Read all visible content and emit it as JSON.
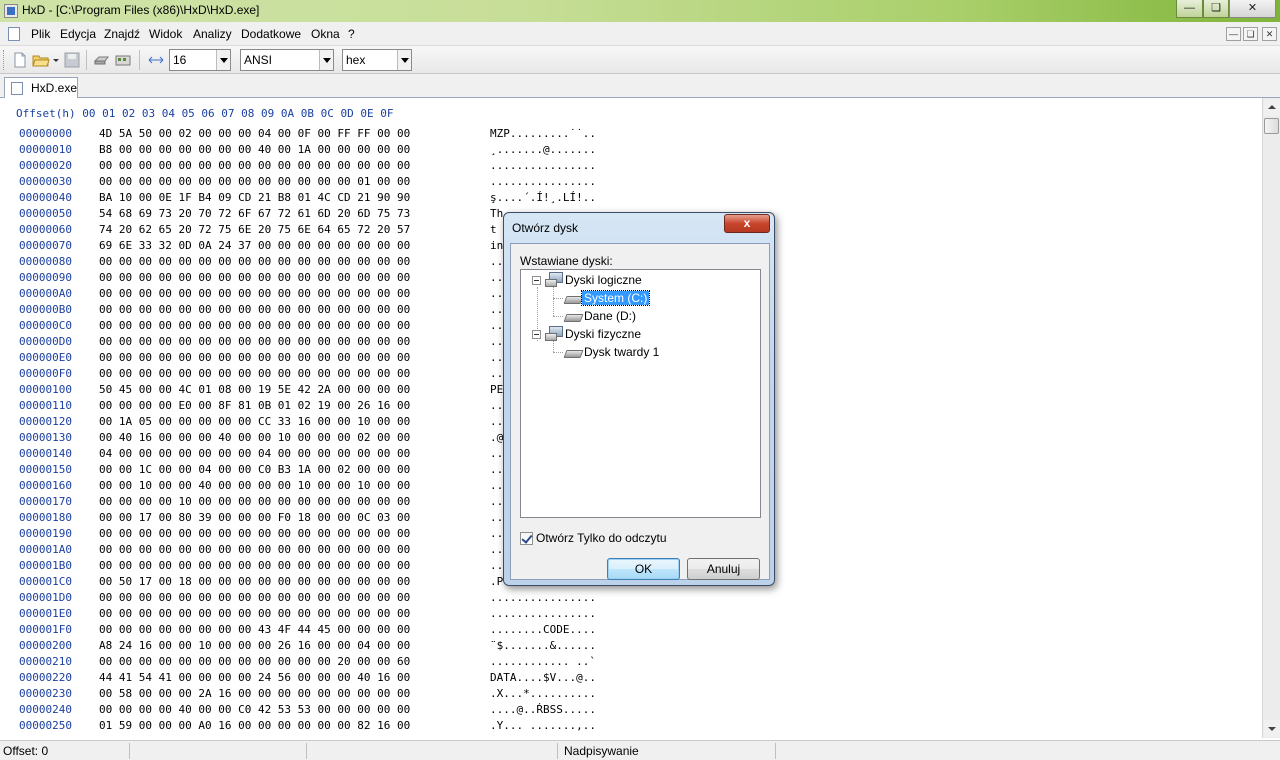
{
  "window": {
    "title": "HxD - [C:\\Program Files (x86)\\HxD\\HxD.exe]"
  },
  "menu": {
    "items": [
      "Plik",
      "Edycja",
      "Znajdź",
      "Widok",
      "Analizy",
      "Dodatkowe",
      "Okna",
      "?"
    ]
  },
  "toolbar": {
    "bytes_per_row": "16",
    "charset": "ANSI",
    "offset_base": "hex"
  },
  "tabs": [
    {
      "label": "HxD.exe"
    }
  ],
  "hex": {
    "header": "Offset(h) 00 01 02 03 04 05 06 07 08 09 0A 0B 0C 0D 0E 0F",
    "rows": [
      {
        "offset": "00000000",
        "bytes": "4D 5A 50 00 02 00 00 00 04 00 0F 00 FF FF 00 00",
        "ascii": "MZP.........˙˙.."
      },
      {
        "offset": "00000010",
        "bytes": "B8 00 00 00 00 00 00 00 40 00 1A 00 00 00 00 00",
        "ascii": "¸.......@......."
      },
      {
        "offset": "00000020",
        "bytes": "00 00 00 00 00 00 00 00 00 00 00 00 00 00 00 00",
        "ascii": "................"
      },
      {
        "offset": "00000030",
        "bytes": "00 00 00 00 00 00 00 00 00 00 00 00 00 01 00 00",
        "ascii": "................"
      },
      {
        "offset": "00000040",
        "bytes": "BA 10 00 0E 1F B4 09 CD 21 B8 01 4C CD 21 90 90",
        "ascii": "ş....´.Í!¸.LÍ!.."
      },
      {
        "offset": "00000050",
        "bytes": "54 68 69 73 20 70 72 6F 67 72 61 6D 20 6D 75 73",
        "ascii": "Th"
      },
      {
        "offset": "00000060",
        "bytes": "74 20 62 65 20 72 75 6E 20 75 6E 64 65 72 20 57",
        "ascii": "t "
      },
      {
        "offset": "00000070",
        "bytes": "69 6E 33 32 0D 0A 24 37 00 00 00 00 00 00 00 00",
        "ascii": "in"
      },
      {
        "offset": "00000080",
        "bytes": "00 00 00 00 00 00 00 00 00 00 00 00 00 00 00 00",
        "ascii": ".."
      },
      {
        "offset": "00000090",
        "bytes": "00 00 00 00 00 00 00 00 00 00 00 00 00 00 00 00",
        "ascii": ".."
      },
      {
        "offset": "000000A0",
        "bytes": "00 00 00 00 00 00 00 00 00 00 00 00 00 00 00 00",
        "ascii": ".."
      },
      {
        "offset": "000000B0",
        "bytes": "00 00 00 00 00 00 00 00 00 00 00 00 00 00 00 00",
        "ascii": ".."
      },
      {
        "offset": "000000C0",
        "bytes": "00 00 00 00 00 00 00 00 00 00 00 00 00 00 00 00",
        "ascii": ".."
      },
      {
        "offset": "000000D0",
        "bytes": "00 00 00 00 00 00 00 00 00 00 00 00 00 00 00 00",
        "ascii": ".."
      },
      {
        "offset": "000000E0",
        "bytes": "00 00 00 00 00 00 00 00 00 00 00 00 00 00 00 00",
        "ascii": ".."
      },
      {
        "offset": "000000F0",
        "bytes": "00 00 00 00 00 00 00 00 00 00 00 00 00 00 00 00",
        "ascii": ".."
      },
      {
        "offset": "00000100",
        "bytes": "50 45 00 00 4C 01 08 00 19 5E 42 2A 00 00 00 00",
        "ascii": "PE"
      },
      {
        "offset": "00000110",
        "bytes": "00 00 00 00 E0 00 8F 81 0B 01 02 19 00 26 16 00",
        "ascii": ".."
      },
      {
        "offset": "00000120",
        "bytes": "00 1A 05 00 00 00 00 00 CC 33 16 00 00 10 00 00",
        "ascii": ".."
      },
      {
        "offset": "00000130",
        "bytes": "00 40 16 00 00 00 40 00 00 10 00 00 00 02 00 00",
        "ascii": ".@"
      },
      {
        "offset": "00000140",
        "bytes": "04 00 00 00 00 00 00 00 04 00 00 00 00 00 00 00",
        "ascii": ".."
      },
      {
        "offset": "00000150",
        "bytes": "00 00 1C 00 00 04 00 00 C0 B3 1A 00 02 00 00 00",
        "ascii": ".."
      },
      {
        "offset": "00000160",
        "bytes": "00 00 10 00 00 40 00 00 00 00 10 00 00 10 00 00",
        "ascii": ".."
      },
      {
        "offset": "00000170",
        "bytes": "00 00 00 00 10 00 00 00 00 00 00 00 00 00 00 00",
        "ascii": ".."
      },
      {
        "offset": "00000180",
        "bytes": "00 00 17 00 80 39 00 00 00 F0 18 00 00 0C 03 00",
        "ascii": ".."
      },
      {
        "offset": "00000190",
        "bytes": "00 00 00 00 00 00 00 00 00 00 00 00 00 00 00 00",
        "ascii": ".."
      },
      {
        "offset": "000001A0",
        "bytes": "00 00 00 00 00 00 00 00 00 00 00 00 00 00 00 00",
        "ascii": ".."
      },
      {
        "offset": "000001B0",
        "bytes": "00 00 00 00 00 00 00 00 00 00 00 00 00 00 00 00",
        "ascii": ".."
      },
      {
        "offset": "000001C0",
        "bytes": "00 50 17 00 18 00 00 00 00 00 00 00 00 00 00 00",
        "ascii": ".P"
      },
      {
        "offset": "000001D0",
        "bytes": "00 00 00 00 00 00 00 00 00 00 00 00 00 00 00 00",
        "ascii": "................"
      },
      {
        "offset": "000001E0",
        "bytes": "00 00 00 00 00 00 00 00 00 00 00 00 00 00 00 00",
        "ascii": "................"
      },
      {
        "offset": "000001F0",
        "bytes": "00 00 00 00 00 00 00 00 43 4F 44 45 00 00 00 00",
        "ascii": "........CODE...."
      },
      {
        "offset": "00000200",
        "bytes": "A8 24 16 00 00 10 00 00 00 26 16 00 00 04 00 00",
        "ascii": "¨$.......&......"
      },
      {
        "offset": "00000210",
        "bytes": "00 00 00 00 00 00 00 00 00 00 00 00 20 00 00 60",
        "ascii": "............ ..`"
      },
      {
        "offset": "00000220",
        "bytes": "44 41 54 41 00 00 00 00 24 56 00 00 00 40 16 00",
        "ascii": "DATA....$V...@.."
      },
      {
        "offset": "00000230",
        "bytes": "00 58 00 00 00 2A 16 00 00 00 00 00 00 00 00 00",
        "ascii": ".X...*.........."
      },
      {
        "offset": "00000240",
        "bytes": "00 00 00 00 40 00 00 C0 42 53 53 00 00 00 00 00",
        "ascii": "....@..ŔBSS....."
      },
      {
        "offset": "00000250",
        "bytes": "01 59 00 00 00 A0 16 00 00 00 00 00 00 82 16 00",
        "ascii": ".Y... .......‚.."
      }
    ]
  },
  "status": {
    "offset": "Offset: 0",
    "mode": "Nadpisywanie"
  },
  "dialog": {
    "title": "Otwórz dysk",
    "close_label": "x",
    "list_label": "Wstawiane dyski:",
    "tree": {
      "logical_label": "Dyski logiczne",
      "logical_items": [
        "System (C:)",
        "Dane (D:)"
      ],
      "physical_label": "Dyski fizyczne",
      "physical_items": [
        "Dysk twardy 1"
      ]
    },
    "readonly_label": "Otwórz Tylko do odczytu",
    "readonly_checked": true,
    "ok_label": "OK",
    "cancel_label": "Anuluj"
  }
}
